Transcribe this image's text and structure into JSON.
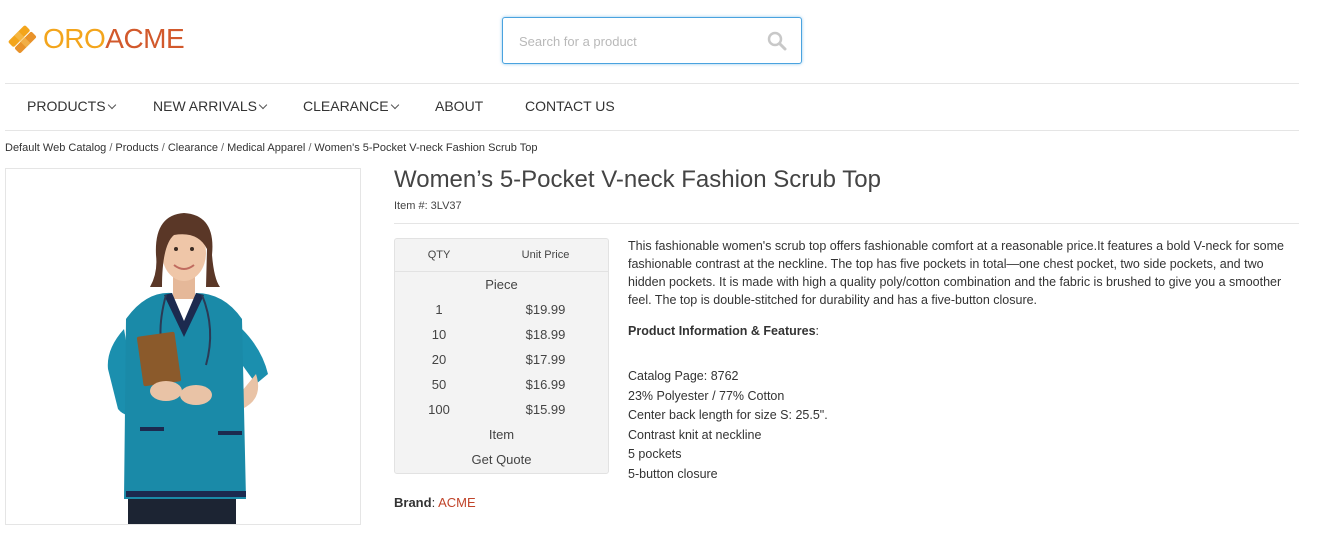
{
  "header": {
    "logo": {
      "part1": "ORO",
      "part2": "ACME"
    },
    "search": {
      "placeholder": "Search for a product",
      "value": ""
    }
  },
  "nav": {
    "items": [
      {
        "label": "PRODUCTS",
        "has_dropdown": true
      },
      {
        "label": "NEW ARRIVALS",
        "has_dropdown": true
      },
      {
        "label": "CLEARANCE",
        "has_dropdown": true
      },
      {
        "label": "ABOUT",
        "has_dropdown": false
      },
      {
        "label": "CONTACT US",
        "has_dropdown": false
      }
    ]
  },
  "breadcrumb": [
    "Default Web Catalog",
    "Products",
    "Clearance",
    "Medical Apparel",
    "Women's 5-Pocket V-neck Fashion Scrub Top"
  ],
  "product": {
    "title": "Women’s 5-Pocket V-neck Fashion Scrub Top",
    "item_number": "Item #: 3LV37",
    "price_table": {
      "qty_header": "QTY",
      "price_header": "Unit Price",
      "unit": "Piece",
      "rows": [
        {
          "qty": "1",
          "price": "$19.99"
        },
        {
          "qty": "10",
          "price": "$18.99"
        },
        {
          "qty": "20",
          "price": "$17.99"
        },
        {
          "qty": "50",
          "price": "$16.99"
        },
        {
          "qty": "100",
          "price": "$15.99"
        }
      ],
      "unit2": "Item",
      "quote_label": "Get Quote"
    },
    "description": "This fashionable women's scrub top offers fashionable comfort at a reasonable price.It features a bold V-neck for some fashionable contrast at the neckline. The top has five pockets in total—one chest pocket, two side pockets, and two hidden pockets. It is made with high a quality poly/cotton combination and the fabric is brushed to give you a smoother feel. The top is double-stitched for durability and has a five-button closure.",
    "features_title": "Product Information & Features",
    "features_colon": ":",
    "features": [
      "Catalog Page: 8762",
      "23% Polyester / 77% Cotton",
      "Center back length for size S: 25.5\".",
      "Contrast knit at neckline",
      "5 pockets",
      "5-button closure"
    ],
    "brand_label": "Brand",
    "brand_colon": ":",
    "brand_value": "ACME"
  },
  "colors": {
    "logo_orange": "#f3a51c",
    "logo_red": "#d2592c",
    "search_border": "#4aa3df",
    "brand_link": "#c0442a",
    "scrub_teal": "#1a8aa8"
  }
}
